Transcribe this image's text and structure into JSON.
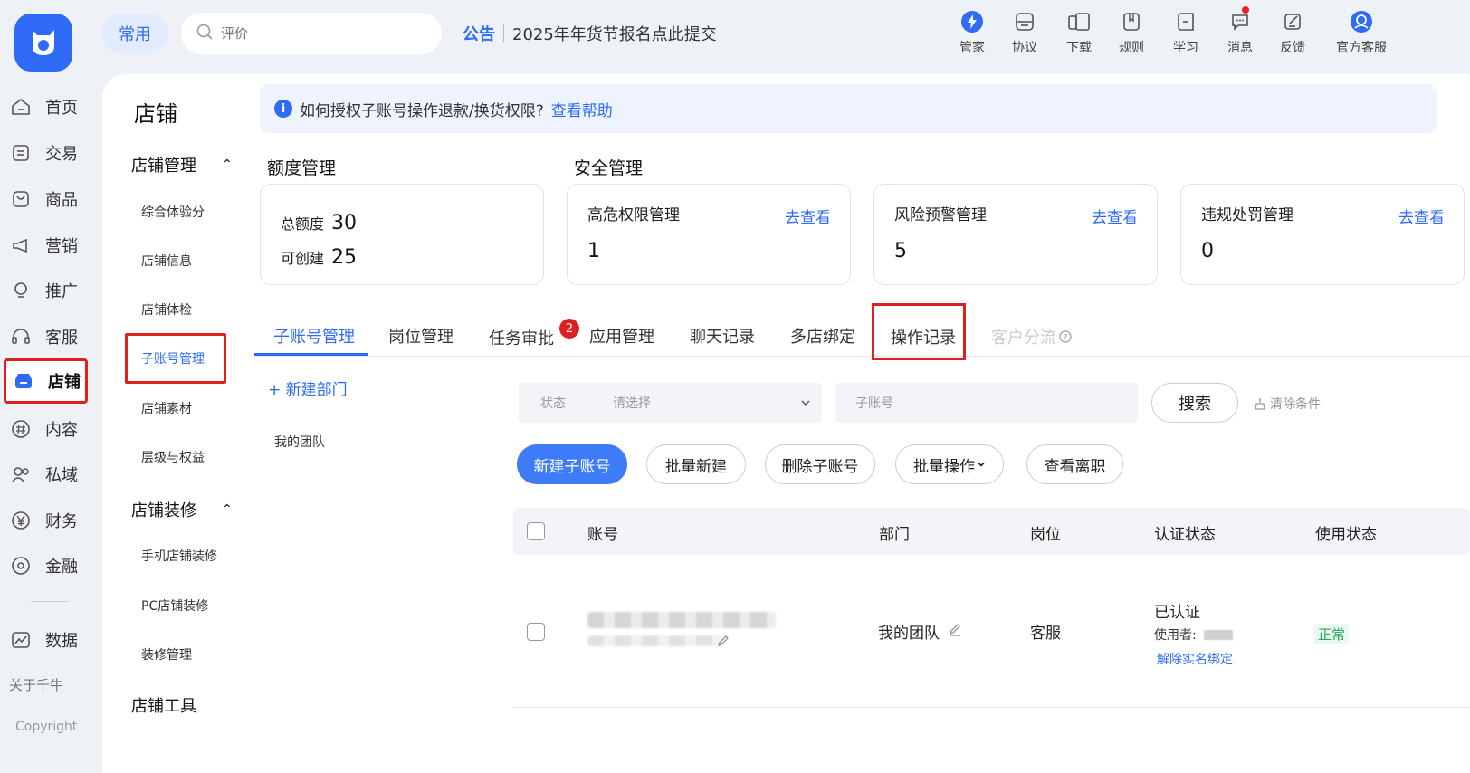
{
  "nav": {
    "items": [
      {
        "label": "首页",
        "icon": "home-icon"
      },
      {
        "label": "交易",
        "icon": "trade-icon"
      },
      {
        "label": "商品",
        "icon": "product-icon"
      },
      {
        "label": "营销",
        "icon": "megaphone-icon"
      },
      {
        "label": "推广",
        "icon": "bulb-icon"
      },
      {
        "label": "客服",
        "icon": "headset-icon"
      },
      {
        "label": "店铺",
        "icon": "store-icon"
      },
      {
        "label": "内容",
        "icon": "hashtag-icon"
      },
      {
        "label": "私域",
        "icon": "users-icon"
      },
      {
        "label": "财务",
        "icon": "yen-icon"
      },
      {
        "label": "金融",
        "icon": "finance-icon"
      },
      {
        "label": "数据",
        "icon": "chart-icon"
      }
    ],
    "active": "店铺",
    "about": "关于千牛",
    "copyright": "Copyright"
  },
  "topbar": {
    "common": "常用",
    "search_placeholder": "评价",
    "announcement_tag": "公告",
    "announcement_text": "2025年年货节报名点此提交",
    "tools": [
      {
        "label": "管家",
        "icon": "lightning-icon"
      },
      {
        "label": "协议",
        "icon": "agreement-icon"
      },
      {
        "label": "下载",
        "icon": "devices-icon"
      },
      {
        "label": "规则",
        "icon": "rules-icon"
      },
      {
        "label": "学习",
        "icon": "study-icon"
      },
      {
        "label": "消息",
        "icon": "message-icon"
      },
      {
        "label": "反馈",
        "icon": "feedback-icon"
      },
      {
        "label": "官方客服",
        "icon": "service-icon"
      }
    ]
  },
  "subnav": {
    "title": "店铺",
    "group1": "店铺管理",
    "group1_items": [
      "综合体验分",
      "店铺信息",
      "店铺体检",
      "子账号管理",
      "店铺素材",
      "层级与权益"
    ],
    "group2": "店铺装修",
    "group2_items": [
      "手机店铺装修",
      "PC店铺装修",
      "装修管理"
    ],
    "group3": "店铺工具"
  },
  "main": {
    "banner_text": "如何授权子账号操作退款/换货权限?",
    "banner_link": "查看帮助",
    "quota_title": "额度管理",
    "security_title": "安全管理",
    "quota": {
      "total_label": "总额度",
      "total": "30",
      "creatable_label": "可创建",
      "creatable": "25"
    },
    "security_cards": [
      {
        "title": "高危权限管理",
        "value": "1",
        "link": "去查看"
      },
      {
        "title": "风险预警管理",
        "value": "5",
        "link": "去查看"
      },
      {
        "title": "违规处罚管理",
        "value": "0",
        "link": "去查看"
      }
    ],
    "tabs": [
      "子账号管理",
      "岗位管理",
      "任务审批",
      "应用管理",
      "聊天记录",
      "多店绑定",
      "操作记录",
      "客户分流"
    ],
    "task_badge": "2",
    "new_dept": "+ 新建部门",
    "my_team": "我的团队",
    "filter": {
      "status_label": "状态",
      "status_placeholder": "请选择",
      "account_placeholder": "子账号",
      "search": "搜索",
      "clear": "清除条件"
    },
    "actions": [
      "新建子账号",
      "批量新建",
      "删除子账号",
      "批量操作",
      "查看离职"
    ],
    "table": {
      "headers": [
        "账号",
        "部门",
        "岗位",
        "认证状态",
        "使用状态"
      ],
      "row": {
        "dept": "我的团队",
        "position": "客服",
        "auth": "已认证",
        "user_label": "使用者:",
        "unbind": "解除实名绑定",
        "status": "正常"
      }
    }
  }
}
